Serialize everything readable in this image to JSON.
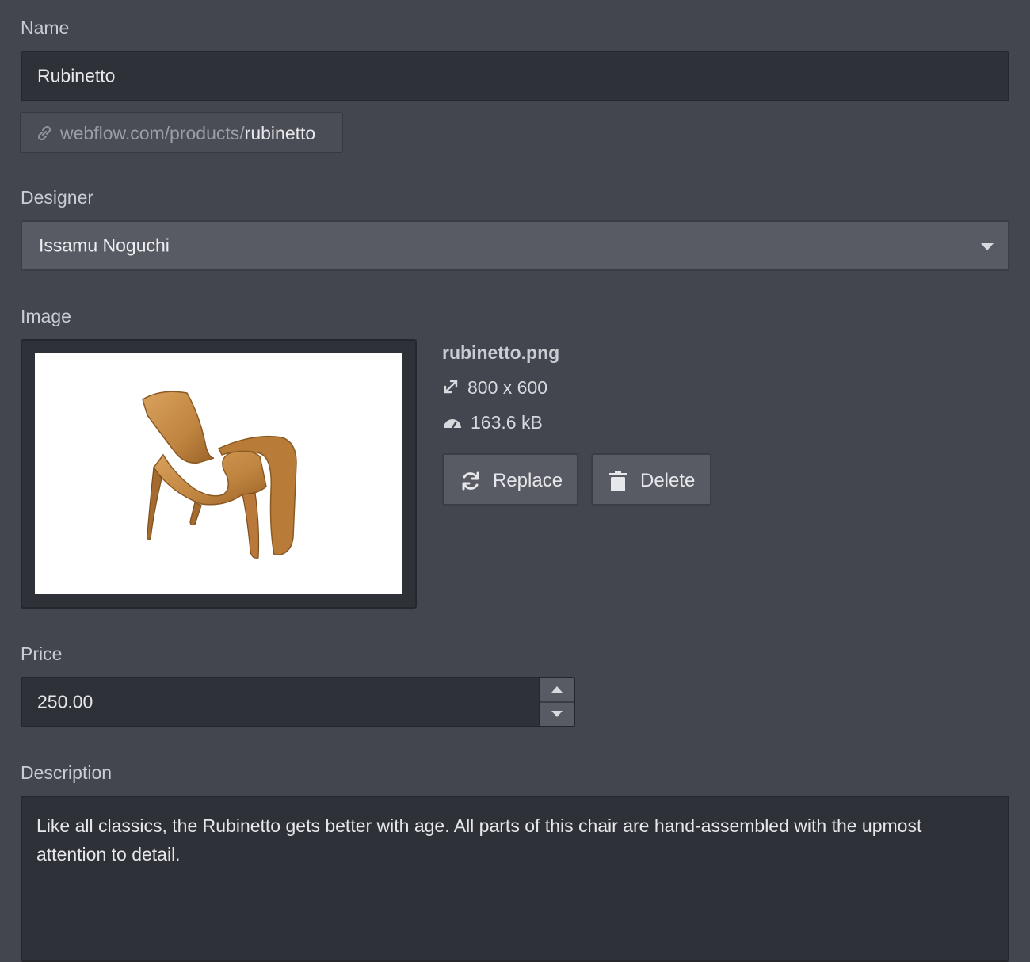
{
  "name": {
    "label": "Name",
    "value": "Rubinetto"
  },
  "slug": {
    "prefix": "webflow.com/products/",
    "value": "rubinetto"
  },
  "designer": {
    "label": "Designer",
    "selected": "Issamu Noguchi"
  },
  "image": {
    "label": "Image",
    "file_name": "rubinetto.png",
    "dimensions": "800 x 600",
    "file_size": "163.6 kB",
    "replace_label": "Replace",
    "delete_label": "Delete"
  },
  "price": {
    "label": "Price",
    "value": "250.00"
  },
  "description": {
    "label": "Description",
    "value": "Like all classics, the Rubinetto gets better with age. All parts of this chair are hand-assembled with the upmost attention to detail."
  },
  "icons": {
    "slug": "link-icon",
    "dimensions": "resize-icon",
    "file_size": "gauge-icon",
    "replace": "refresh-icon",
    "delete": "trash-icon",
    "designer_caret": "caret-down-icon"
  },
  "colors": {
    "background": "#43464e",
    "input": "#2e3137",
    "button": "#585b63"
  }
}
